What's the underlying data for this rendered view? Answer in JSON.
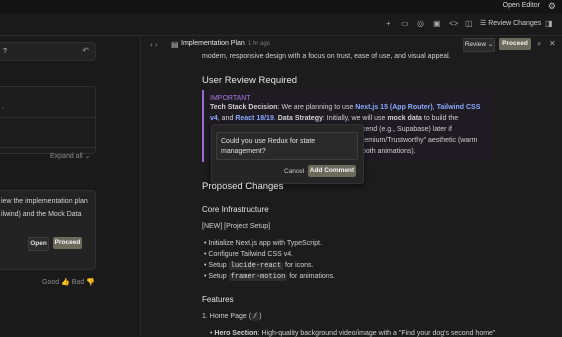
{
  "topbar": {
    "open_editor": "Open Editor"
  },
  "toolbar": {
    "review_changes": "Review Changes"
  },
  "left": {
    "message_preview": "?",
    "thought_text": ".",
    "expand_all": "Expand all",
    "plan_line1": "iew the implementation plan",
    "plan_line2": "ilwind) and the Mock Data",
    "open_label": "Open",
    "proceed_label": "Proceed",
    "feedback_good": "Good",
    "feedback_bad": "Bad"
  },
  "doc": {
    "title": "Implementation Plan",
    "time": "1 hr ago",
    "review_label": "Review",
    "proceed_label": "Proceed",
    "intro": "modern, responsive design with a focus on trust, ease of use, and visual appeal.",
    "review_heading": "User Review Required",
    "important": "IMPORTANT",
    "imp_line1_a": "Tech Stack Decision",
    "imp_line1_b": ": We are planning to use ",
    "imp_line1_c": "Next.js 15 (App Router)",
    "imp_line1_d": ", ",
    "imp_line1_e": "Tailwind CSS",
    "imp_line2_a": "v4",
    "imp_line2_b": ", and ",
    "imp_line2_c": "React 18/19",
    "imp_line2_d": ". ",
    "imp_line2_e": "Data Strategy",
    "imp_line2_f": ": Initially, we will use ",
    "imp_line2_g": "mock data",
    "imp_line2_h": " to build the",
    "imp_line3": "kend (e.g., Supabase) later if",
    "imp_line4": "remium/Trustworthy\" aesthetic (warm",
    "imp_line5": "ooth animations).",
    "comment_text": "Could you use Redux for state management?",
    "cancel_label": "Cancel",
    "add_comment_label": "Add Comment",
    "proposed_heading": "Proposed Changes",
    "core_heading": "Core Infrastructure",
    "new_tag": "[NEW] [Project Setup]",
    "bullet1": "Initialize Next.js app with TypeScript.",
    "bullet2": "Configure Tailwind CSS v4.",
    "bullet3_a": "Setup ",
    "bullet3_code": "lucide-react",
    "bullet3_b": " for icons.",
    "bullet4_a": "Setup ",
    "bullet4_code": "framer-motion",
    "bullet4_b": " for animations.",
    "features_heading": "Features",
    "home_page_a": "1. Home Page (",
    "home_page_code": "/",
    "home_page_b": ")",
    "hero_a": "Hero Section",
    "hero_b": ": High-quality background video/image with a \"Find your dog's second home\""
  },
  "colors": {
    "accent_purple": "#9b6bd6",
    "link_blue": "#8aa8ff",
    "proceed": "#6b6b5c"
  }
}
